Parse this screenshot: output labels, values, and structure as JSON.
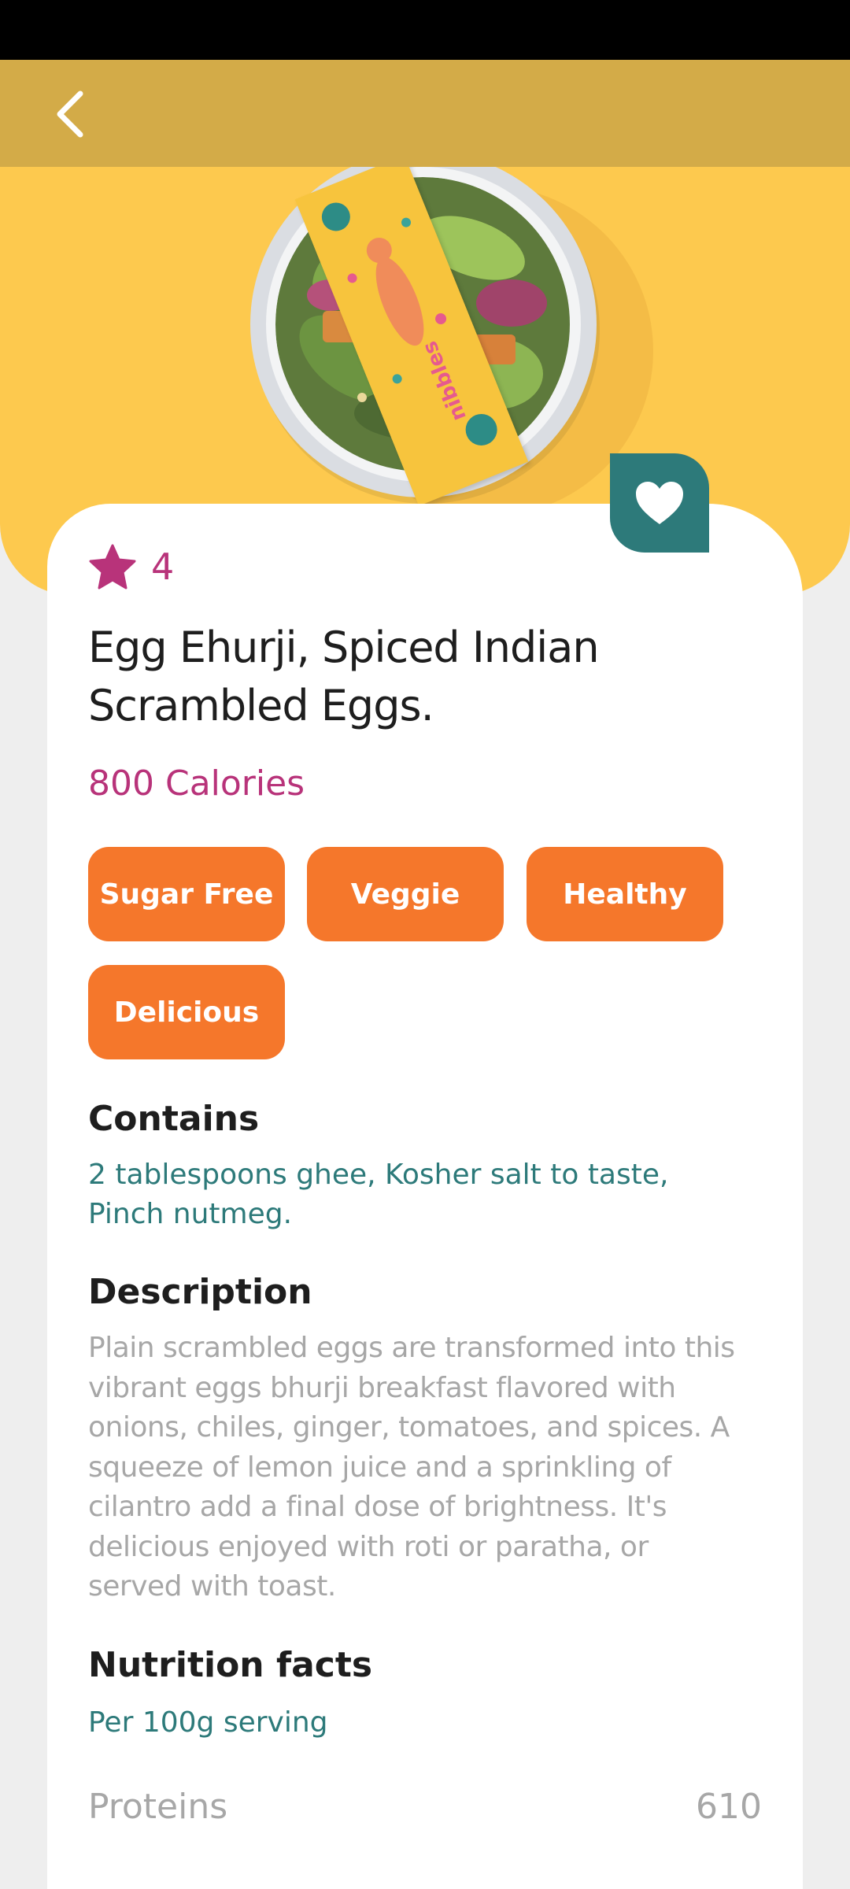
{
  "rating": {
    "value": "4"
  },
  "recipe": {
    "title": "Egg Ehurji, Spiced Indian Scrambled Eggs.",
    "calories": "800 Calories"
  },
  "tags": [
    "Sugar Free",
    "Veggie",
    "Healthy",
    "Delicious"
  ],
  "contains": {
    "heading": "Contains",
    "text": "2 tablespoons ghee, Kosher salt to taste, Pinch nutmeg."
  },
  "description": {
    "heading": "Description",
    "text": "Plain scrambled eggs are transformed into this vibrant eggs bhurji breakfast flavored with onions, chiles, ginger, tomatoes, and spices. A squeeze of lemon juice and a sprinkling of cilantro add a final dose of brightness. It's delicious enjoyed with roti or paratha, or served with toast."
  },
  "nutrition": {
    "heading": "Nutrition facts",
    "serving": "Per 100g serving",
    "rows": [
      {
        "label": "Proteins",
        "value": "610"
      }
    ]
  },
  "image": {
    "sleeve_text": "nibbles"
  },
  "colors": {
    "hero": "#FDC94E",
    "appbar": "#D3AB48",
    "accent_pink": "#B8337A",
    "accent_teal": "#2D7A7A",
    "tag_orange": "#F5772B"
  },
  "icons": {
    "back": "chevron-left-icon",
    "favorite": "heart-icon",
    "rating": "star-icon"
  }
}
